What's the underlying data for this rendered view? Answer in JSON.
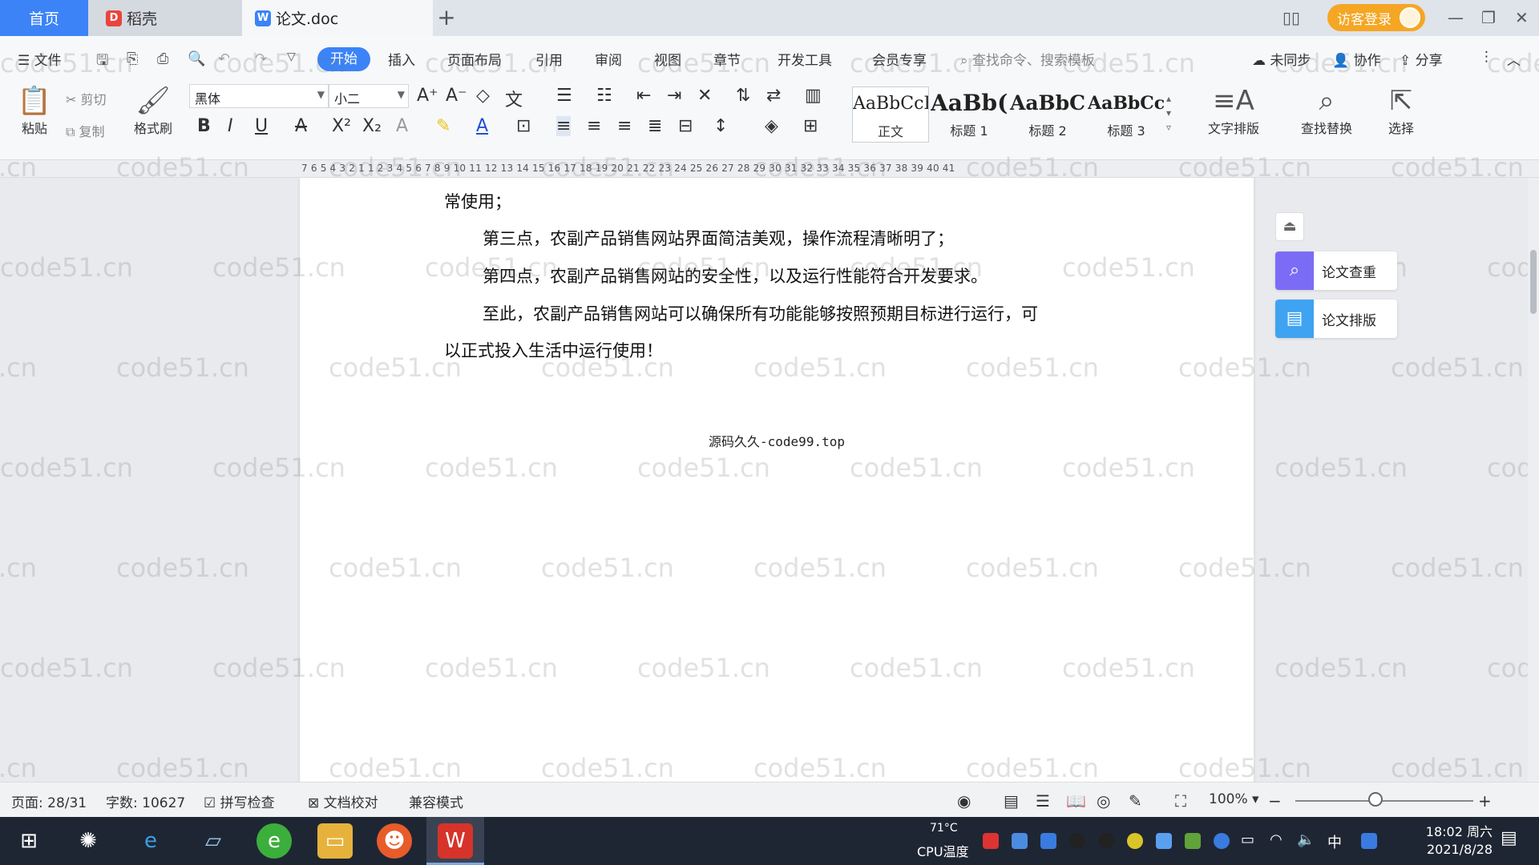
{
  "tabs": {
    "home": "首页",
    "docer": "稻壳",
    "doc": "论文.doc"
  },
  "titlebar": {
    "login": "访客登录"
  },
  "menu": {
    "file": "文件",
    "items": [
      "开始",
      "插入",
      "页面布局",
      "引用",
      "审阅",
      "视图",
      "章节",
      "开发工具",
      "会员专享"
    ],
    "search_placeholder": "查找命令、搜索模板",
    "sync": "未同步",
    "collab": "协作",
    "share": "分享"
  },
  "ribbon": {
    "paste": "粘贴",
    "cut": "剪切",
    "copy": "复制",
    "format_painter": "格式刷",
    "font_name": "黑体",
    "font_size": "小二",
    "styles": [
      {
        "sample": "AaBbCcI",
        "name": "正文"
      },
      {
        "sample": "AaBb(",
        "name": "标题 1"
      },
      {
        "sample": "AaBbC",
        "name": "标题 2"
      },
      {
        "sample": "AaBbCcl",
        "name": "标题 3"
      }
    ],
    "text_layout": "文字排版",
    "find_replace": "查找替换",
    "select": "选择"
  },
  "ruler": {
    "numbers": "7  6  5  4  3  2  1     1  2  3  4  5  6  7  8  9  10 11 12 13 14 15 16 17 18 19 20 21 22 23 24 25 26 27 28 29 30 31 32 33 34 35 36 37 38 39 40 41"
  },
  "document": {
    "lines": [
      "常使用；",
      "第三点，农副产品销售网站界面简洁美观，操作流程清晰明了；",
      "第四点，农副产品销售网站的安全性，以及运行性能符合开发要求。",
      "至此，农副产品销售网站可以确保所有功能能够按照预期目标进行运行，可",
      "以正式投入生活中运行使用！"
    ],
    "footer": "源码久久-code99.top"
  },
  "watermark": "code51.cn",
  "side_panel": {
    "check": "论文查重",
    "layout": "论文排版"
  },
  "status": {
    "page": "页面: 28/31",
    "words": "字数: 10627",
    "spell": "拼写检查",
    "proof": "文档校对",
    "compat": "兼容模式",
    "zoom": "100%"
  },
  "taskbar": {
    "temp": "71°C",
    "cpu": "CPU温度",
    "ime": "中",
    "time": "18:02 周六",
    "date": "2021/8/28"
  },
  "colors": {
    "accent": "#3b83f7",
    "login": "#f5a623",
    "check_icon": "#7b6cf6",
    "layout_icon": "#3fa3f2"
  }
}
